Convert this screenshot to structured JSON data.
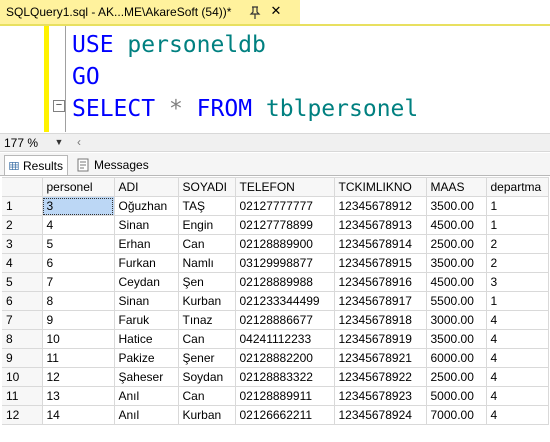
{
  "tab": {
    "title": "SQLQuery1.sql - AK...ME\\AkareSoft (54))*"
  },
  "editor": {
    "line1": {
      "kw": "USE",
      "id": "personeldb"
    },
    "line2": {
      "kw": "GO"
    },
    "line3": {
      "kw1": "SELECT",
      "star": "*",
      "kw2": "FROM",
      "id": "tblpersonel"
    }
  },
  "zoom": {
    "value": "177 %"
  },
  "results_tabs": [
    {
      "label": "Results",
      "icon": "grid-icon",
      "active": true
    },
    {
      "label": "Messages",
      "icon": "messages-icon",
      "active": false
    }
  ],
  "grid": {
    "columns": [
      "",
      "personel",
      "ADI",
      "SOYADI",
      "TELEFON",
      "TCKIMLIKNO",
      "MAAS",
      "departma"
    ],
    "rows": [
      [
        "1",
        "3",
        "Oğuzhan",
        "TAŞ",
        "02127777777",
        "12345678912",
        "3500.00",
        "1"
      ],
      [
        "2",
        "4",
        "Sinan",
        "Engin",
        "02127778899",
        "12345678913",
        "4500.00",
        "1"
      ],
      [
        "3",
        "5",
        "Erhan",
        "Can",
        "02128889900",
        "12345678914",
        "2500.00",
        "2"
      ],
      [
        "4",
        "6",
        "Furkan",
        "Namlı",
        "03129998877",
        "12345678915",
        "3500.00",
        "2"
      ],
      [
        "5",
        "7",
        "Ceydan",
        "Şen",
        "02128889988",
        "12345678916",
        "4500.00",
        "3"
      ],
      [
        "6",
        "8",
        "Sinan",
        "Kurban",
        "021233344499",
        "12345678917",
        "5500.00",
        "1"
      ],
      [
        "7",
        "9",
        "Faruk",
        "Tınaz",
        "02128886677",
        "12345678918",
        "3000.00",
        "4"
      ],
      [
        "8",
        "10",
        "Hatice",
        "Can",
        "04241112233",
        "12345678919",
        "3500.00",
        "4"
      ],
      [
        "9",
        "11",
        "Pakize",
        "Şener",
        "02128882200",
        "12345678921",
        "6000.00",
        "4"
      ],
      [
        "10",
        "12",
        "Şaheser",
        "Soydan",
        "02128883322",
        "12345678922",
        "2500.00",
        "4"
      ],
      [
        "11",
        "13",
        "Anıl",
        "Can",
        "02128889911",
        "12345678923",
        "5000.00",
        "4"
      ],
      [
        "12",
        "14",
        "Anıl",
        "Kurban",
        "02126662211",
        "12345678924",
        "7000.00",
        "4"
      ]
    ]
  },
  "colors": {
    "tab_bg": "#fff29d",
    "keyword": "#0000ff",
    "identifier": "#008080",
    "selected_cell": "#bcd7f5"
  }
}
